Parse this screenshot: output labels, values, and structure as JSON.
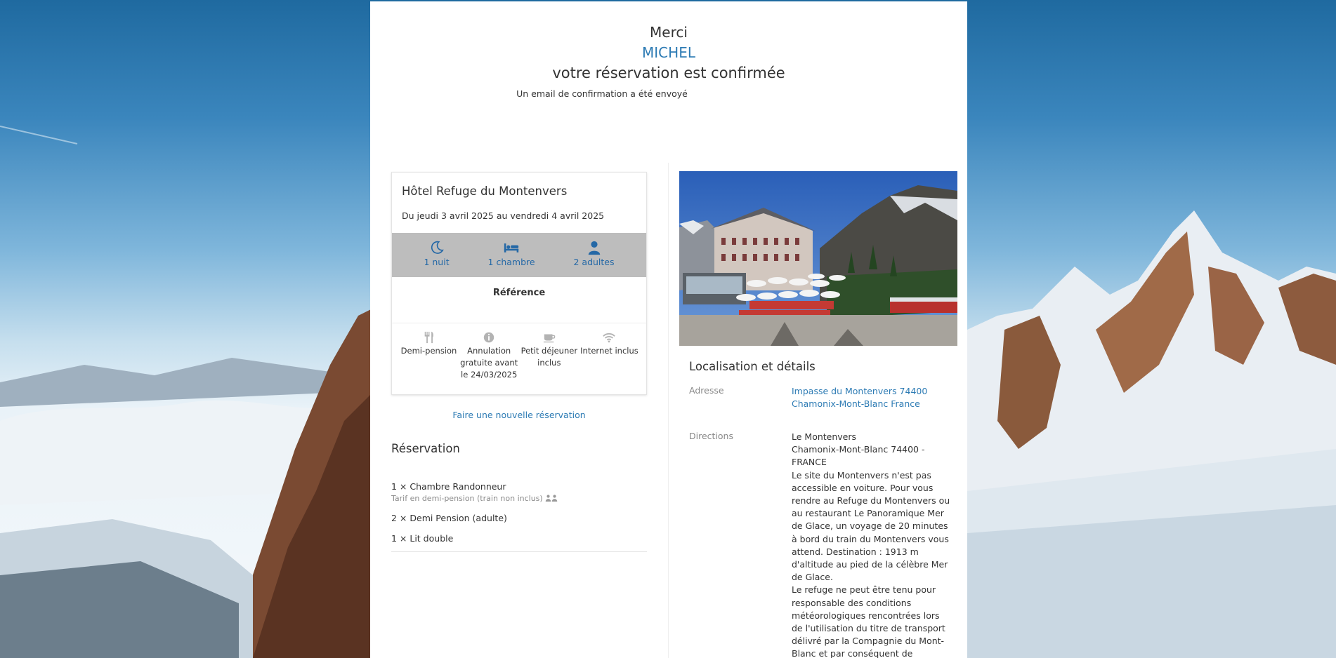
{
  "thanks": {
    "merci": "Merci",
    "name": "MICHEL",
    "confirmation": "votre réservation est confirmée",
    "email_sent": "Un email de confirmation a été envoyé"
  },
  "booking_card": {
    "hotel_name": "Hôtel Refuge du Montenvers",
    "dates": "Du jeudi 3 avril 2025 au vendredi 4 avril 2025",
    "stats": {
      "nights": "1 nuit",
      "rooms": "1 chambre",
      "adults": "2 adultes"
    },
    "reference_label": "Référence",
    "amenities": [
      {
        "label": "Demi-pension",
        "icon": "cutlery-icon"
      },
      {
        "label": "Annulation gratuite avant le 24/03/2025",
        "icon": "info-icon"
      },
      {
        "label": "Petit déjeuner inclus",
        "icon": "coffee-icon"
      },
      {
        "label": "Internet inclus",
        "icon": "wifi-icon"
      }
    ]
  },
  "new_reservation_link": "Faire une nouvelle réservation",
  "reservation": {
    "title": "Réservation",
    "items": [
      {
        "label": "1 × Chambre Randonneur",
        "sub": "Tarif en demi-pension (train non inclus)"
      },
      {
        "label": "2 × Demi Pension (adulte)"
      },
      {
        "label": "1 × Lit double"
      }
    ]
  },
  "location": {
    "title": "Localisation et détails",
    "address_label": "Adresse",
    "address": "Impasse du Montenvers 74400 Chamonix-Mont-Blanc France",
    "directions_label": "Directions",
    "directions": [
      "Le Montenvers",
      "Chamonix-Mont-Blanc 74400 - FRANCE",
      "Le site du Montenvers n'est pas accessible en voiture. Pour vous rendre au Refuge du Montenvers ou au restaurant Le Panoramique Mer de Glace, un voyage de 20 minutes à bord du train du Montenvers vous attend. Destination : 1913 m d'altitude au pied de la célèbre Mer de Glace.",
      "Le refuge ne peut être tenu pour responsable des conditions météorologiques rencontrées lors de l'utilisation du titre de transport délivré par la Compagnie du Mont-Blanc et par conséquent de"
    ]
  },
  "colors": {
    "accent": "#2d7bb4",
    "stats_bar": "#bdbdbd",
    "stat_icon": "#2468a6"
  }
}
